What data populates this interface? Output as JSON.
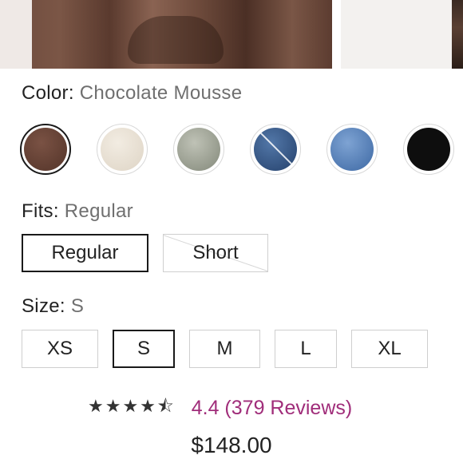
{
  "color": {
    "label": "Color:",
    "selected": "Chocolate Mousse",
    "swatches": [
      {
        "name": "chocolate-mousse",
        "color": "#6a4538",
        "selected": true,
        "unavailable": false
      },
      {
        "name": "ivory",
        "color": "#ebe4d8",
        "selected": false,
        "unavailable": false
      },
      {
        "name": "heather-grey",
        "color": "#a8ab9e",
        "selected": false,
        "unavailable": false
      },
      {
        "name": "dark-denim",
        "color": "#3d5f8e",
        "selected": false,
        "unavailable": true
      },
      {
        "name": "light-denim",
        "color": "#5c86bf",
        "selected": false,
        "unavailable": false
      },
      {
        "name": "black",
        "color": "#111111",
        "selected": false,
        "unavailable": false
      }
    ]
  },
  "fits": {
    "label": "Fits:",
    "selected": "Regular",
    "options": [
      "Regular",
      "Short"
    ]
  },
  "size": {
    "label": "Size:",
    "selected": "S",
    "options": [
      "XS",
      "S",
      "M",
      "L",
      "XL"
    ]
  },
  "rating": {
    "stars": "★★★★⯪",
    "value": 4.4,
    "text": "4.4 (379 Reviews)"
  },
  "price": "$148.00"
}
